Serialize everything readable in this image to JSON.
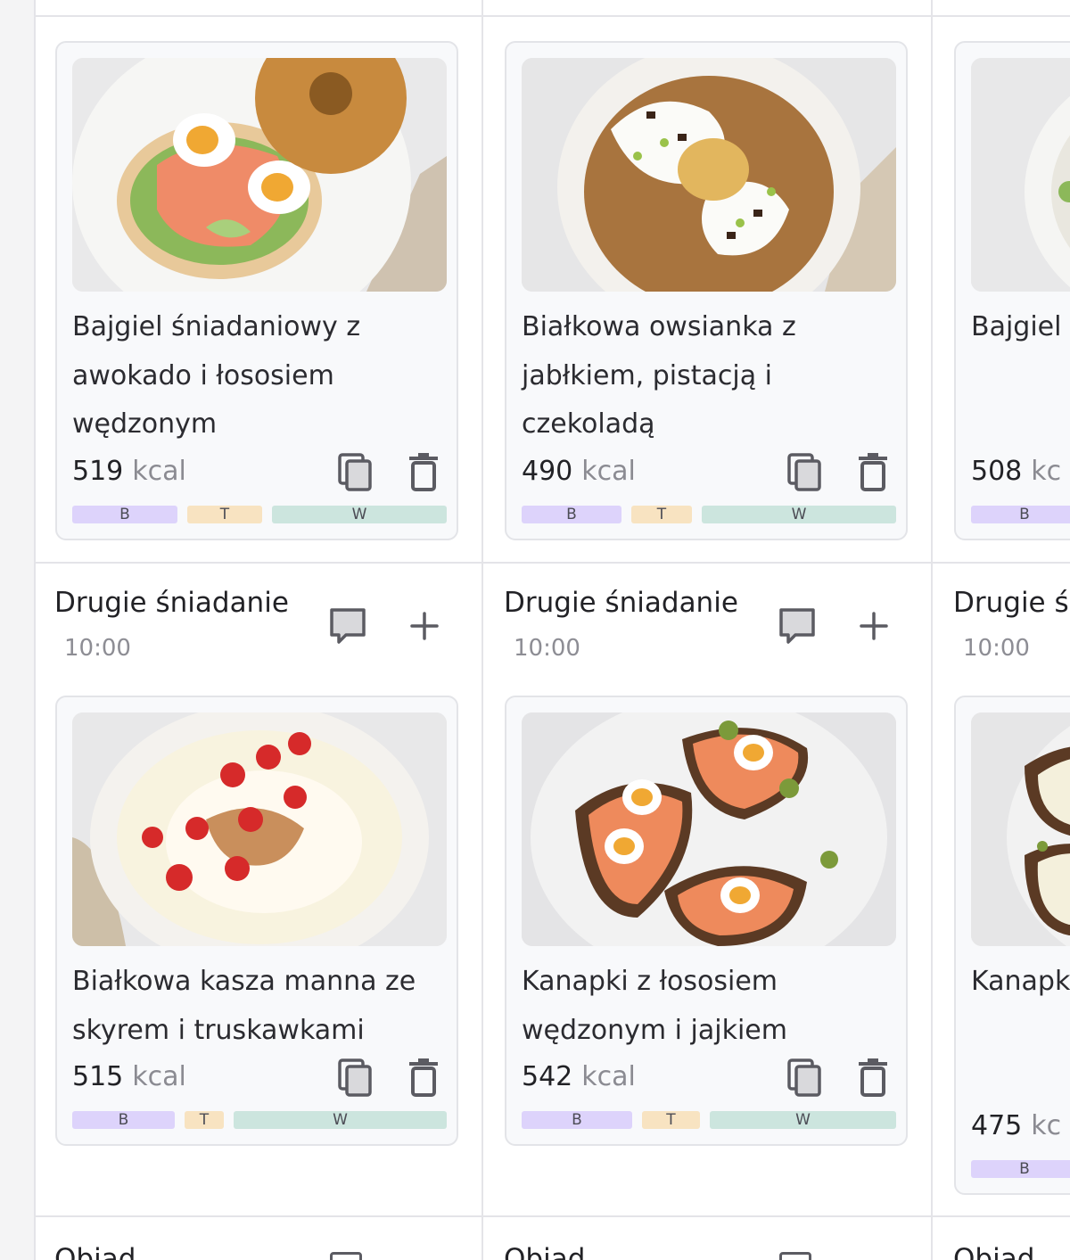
{
  "colors": {
    "macro_b": "#ddd3fb",
    "macro_t": "#f8e3c1",
    "macro_w": "#cce5de",
    "card_bg": "#f8f9fb",
    "divider": "#e4e4e8"
  },
  "macro_labels": {
    "b": "B",
    "t": "T",
    "w": "W"
  },
  "icons": {
    "note": "note-icon",
    "add": "plus-icon",
    "copy": "copy-icon",
    "delete": "trash-icon"
  },
  "columns": [
    {
      "section1_meal": {
        "dish": {
          "title": "Bajgiel śniadaniowy z awokado i łososiem wędzonym",
          "kcal": "519",
          "kcal_unit": "kcal",
          "image": "bagel with avocado, smoked salmon and eggs",
          "macros": {
            "b": 0.28,
            "t": 0.22,
            "w": 0.5
          }
        }
      },
      "section2_meal": {
        "name": "Drugie śniadanie",
        "time": "10:00",
        "dish": {
          "title": "Białkowa kasza manna ze skyrem i truskawkami",
          "kcal": "515",
          "kcal_unit": "kcal",
          "image": "semolina bowl with skyr and strawberries",
          "macros": {
            "b": 0.29,
            "t": 0.12,
            "w": 0.59
          }
        }
      },
      "section3_meal": {
        "name": "Obiad"
      }
    },
    {
      "section1_meal": {
        "dish": {
          "title": "Białkowa owsianka z jabłkiem, pistacją i czekoladą",
          "kcal": "490",
          "kcal_unit": "kcal",
          "image": "oatmeal with apple, pistachio and chocolate",
          "macros": {
            "b": 0.28,
            "t": 0.17,
            "w": 0.55
          }
        }
      },
      "section2_meal": {
        "name": "Drugie śniadanie",
        "time": "10:00",
        "dish": {
          "title": "Kanapki z łososiem wędzonym i jajkiem",
          "kcal": "542",
          "kcal_unit": "kcal",
          "image": "smoked salmon and egg sandwiches",
          "macros": {
            "b": 0.31,
            "t": 0.17,
            "w": 0.52
          }
        }
      },
      "section3_meal": {
        "name": "Obiad"
      }
    },
    {
      "section1_meal": {
        "dish": {
          "title": "Bajgiel awokado i serem",
          "kcal": "508",
          "kcal_unit": "kc",
          "image": "bagel with avocado and cheese",
          "macros": {
            "b": 0.25,
            "t": 0.2,
            "w": 0.55
          }
        }
      },
      "section2_meal": {
        "name": "Drugie ś",
        "time": "10:00",
        "dish": {
          "title": "Kanapk sałatka rzodkie",
          "kcal": "475",
          "kcal_unit": "kc",
          "image": "sandwiches with cheese and radish salad",
          "macros": {
            "b": 0.25,
            "t": 0.2,
            "w": 0.55
          }
        }
      },
      "section3_meal": {
        "name": "Obiad"
      }
    }
  ]
}
